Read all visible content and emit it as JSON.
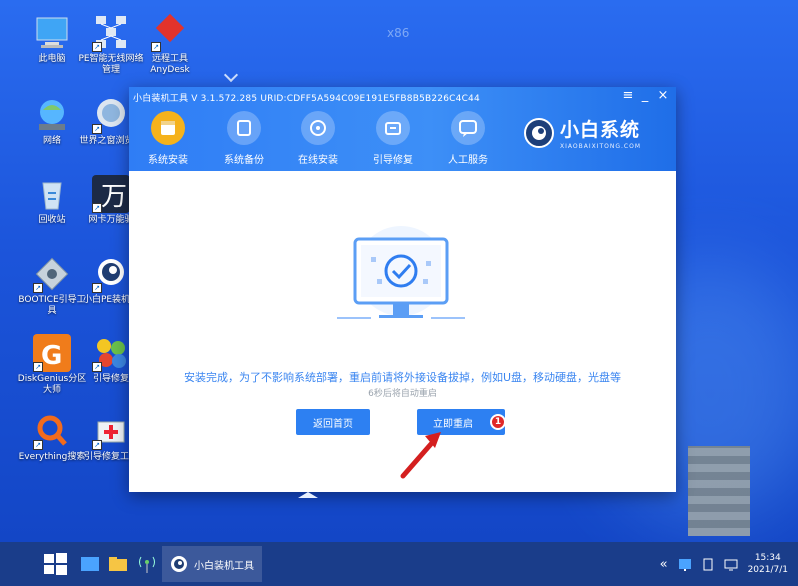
{
  "desktop": {
    "watermark": "x86",
    "icons": [
      {
        "label": "此电脑",
        "icon": "computer-icon"
      },
      {
        "label": "PE智能无线网络管理",
        "icon": "network-manager-icon"
      },
      {
        "label": "远程工具AnyDesk",
        "icon": "anydesk-icon"
      },
      {
        "label": "网络",
        "icon": "network-icon"
      },
      {
        "label": "世界之窗浏览器",
        "icon": "browser-icon"
      },
      {
        "label": "回收站",
        "icon": "recycle-bin-icon"
      },
      {
        "label": "网卡万能驱",
        "icon": "driver-icon"
      },
      {
        "label": "BOOTICE引导工具",
        "icon": "bootice-icon"
      },
      {
        "label": "小白PE装机具",
        "icon": "xiaobai-pe-icon"
      },
      {
        "label": "DiskGenius分区大师",
        "icon": "diskgenius-icon"
      },
      {
        "label": "引导修复",
        "icon": "boot-repair-icon"
      },
      {
        "label": "Everything搜索",
        "icon": "everything-icon"
      },
      {
        "label": "引导修复工具",
        "icon": "repair-tool-icon"
      }
    ]
  },
  "window": {
    "title": "小白装机工具 V 3.1.572.285 URID:CDFF5A594C09E191E5FB8B5B226C4C44",
    "controls": [
      "≡",
      "_",
      "×"
    ],
    "nav": [
      {
        "label": "系统安装",
        "icon": "system-install-icon",
        "active": true
      },
      {
        "label": "系统备份",
        "icon": "system-backup-icon",
        "active": false
      },
      {
        "label": "在线安装",
        "icon": "online-install-icon",
        "active": false
      },
      {
        "label": "引导修复",
        "icon": "boot-repair-icon",
        "active": false
      },
      {
        "label": "人工服务",
        "icon": "chat-service-icon",
        "active": false
      }
    ],
    "brand": {
      "name": "小白系统",
      "sub": "XIAOBAIXITONG.COM"
    },
    "message": "安装完成，为了不影响系统部署，重启前请将外接设备拔掉，例如U盘，移动硬盘，光盘等",
    "countdown": "6秒后将自动重启",
    "buttons": {
      "home": "返回首页",
      "restart": "立即重启",
      "badge": "1"
    }
  },
  "taskbar": {
    "app_label": "小白装机工具",
    "tray_arrow": "«",
    "time": "15:34",
    "date": "2021/7/1"
  },
  "colors": {
    "accent": "#2d80f2",
    "header": "#3d8ff7",
    "active_nav": "#f5b21c",
    "badge": "#e02828"
  }
}
